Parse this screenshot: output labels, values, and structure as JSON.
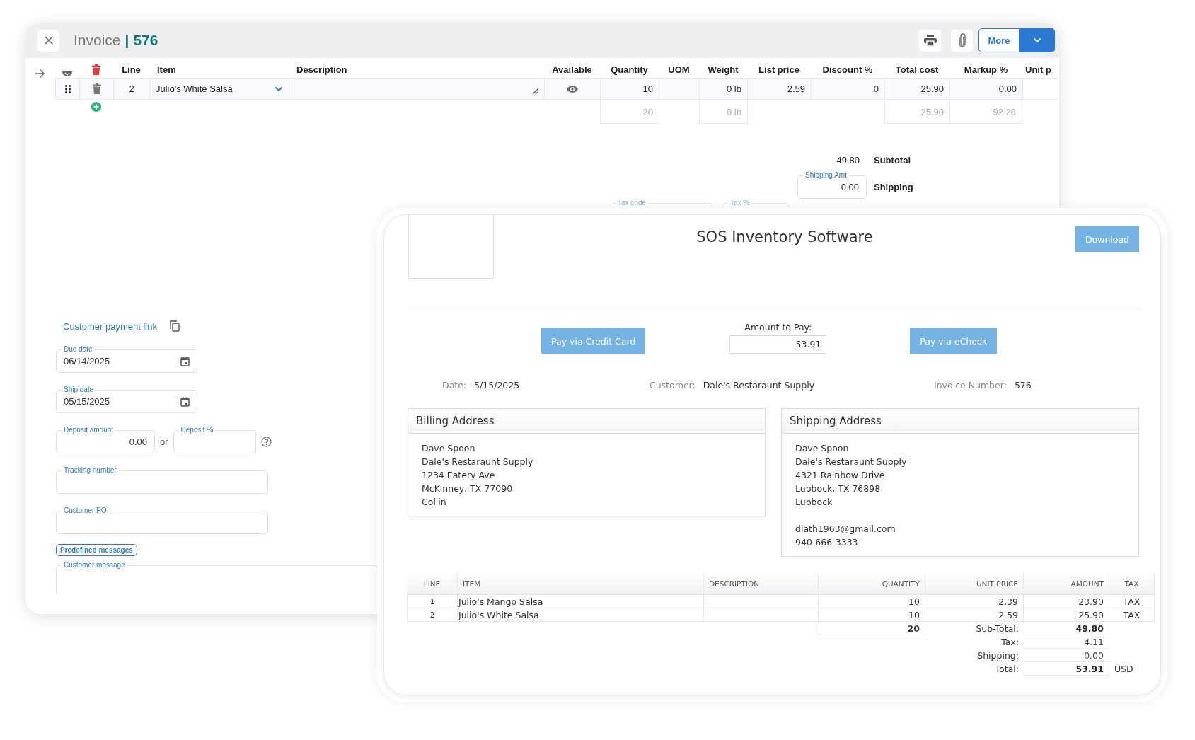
{
  "editor": {
    "title": "Invoice",
    "separator": "|",
    "number": "576",
    "more": "More",
    "columns": [
      "Line",
      "Item",
      "Description",
      "Available",
      "Quantity",
      "UOM",
      "Weight",
      "List price",
      "Discount %",
      "Total cost",
      "Markup %",
      "Unit p"
    ],
    "lines": [
      {
        "line": "2",
        "item": "Julio's White Salsa",
        "quantity": "10",
        "weight": "0 lb",
        "list_price": "2.59",
        "discount": "0",
        "total_cost": "25.90",
        "markup": "0.00"
      }
    ],
    "totals_row": {
      "quantity": "20",
      "weight": "0 lb",
      "total_cost": "25.90",
      "markup": "92.28"
    },
    "subtotal": {
      "value": "49.80",
      "label": "Subtotal"
    },
    "shipping": {
      "field_label": "Shipping Amt",
      "value": "0.00",
      "label": "Shipping"
    },
    "tax_fields": [
      "Tax code",
      "Tax %"
    ],
    "payment_link": "Customer payment link",
    "date_fields": [
      {
        "label": "Due date",
        "value": "06/14/2025"
      },
      {
        "label": "Ship date",
        "value": "05/15/2025"
      }
    ],
    "deposit": {
      "amount_label": "Deposit amount",
      "amount": "0.00",
      "or": "or",
      "percent_label": "Deposit %"
    },
    "text_fields": [
      "Tracking number",
      "Customer PO"
    ],
    "predefined": "Predefined messages",
    "message_label": "Customer message"
  },
  "portal": {
    "company": "SOS Inventory Software",
    "download": "Download",
    "pay_card": "Pay via Credit Card",
    "amount_label": "Amount to Pay:",
    "amount": "53.91",
    "pay_echeck": "Pay via eCheck",
    "info": [
      {
        "label": "Date:",
        "value": "5/15/2025"
      },
      {
        "label": "Customer:",
        "value": "Dale's Restaraunt Supply"
      },
      {
        "label": "Invoice Number:",
        "value": "576"
      }
    ],
    "addresses": [
      {
        "title": "Billing Address",
        "lines": [
          "Dave Spoon",
          "Dale's Restaraunt Supply",
          "1234 Eatery Ave",
          "McKinney, TX 77090",
          "Collin"
        ]
      },
      {
        "title": "Shipping Address",
        "lines": [
          "Dave Spoon",
          "Dale's Restaraunt Supply",
          "4321 Rainbow Drive",
          "Lubbock, TX 76898",
          "Lubbock"
        ],
        "contact": [
          "dlath1963@gmail.com",
          "940-666-3333"
        ]
      }
    ],
    "columns": [
      "LINE",
      "ITEM",
      "DESCRIPTION",
      "QUANTITY",
      "UNIT PRICE",
      "AMOUNT",
      "TAX"
    ],
    "rows": [
      {
        "line": "1",
        "item": "Julio's Mango Salsa",
        "quantity": "10",
        "unit_price": "2.39",
        "amount": "23.90",
        "tax": "TAX"
      },
      {
        "line": "2",
        "item": "Julio's White Salsa",
        "quantity": "10",
        "unit_price": "2.59",
        "amount": "25.90",
        "tax": "TAX"
      }
    ],
    "total_quantity": "20",
    "summary": [
      {
        "label": "Sub-Total:",
        "value": "49.80",
        "emphasis": true
      },
      {
        "label": "Tax:",
        "value": "4.11",
        "emphasis": false
      },
      {
        "label": "Shipping:",
        "value": "0.00",
        "emphasis": false
      },
      {
        "label": "Total:",
        "value": "53.91",
        "emphasis": true,
        "currency": "USD"
      }
    ]
  }
}
